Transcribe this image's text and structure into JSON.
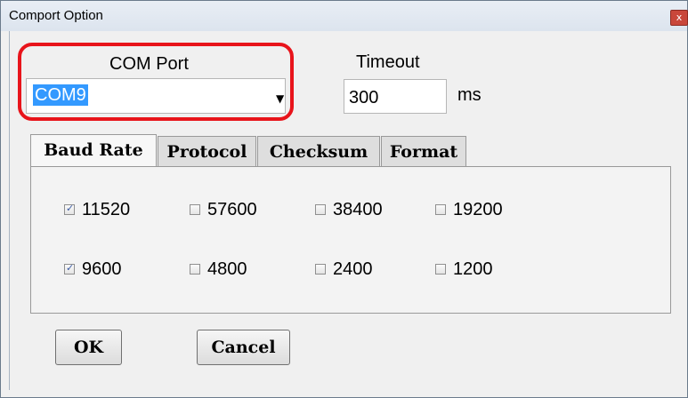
{
  "window": {
    "title": "Comport Option",
    "close_glyph": "x"
  },
  "com_port": {
    "label": "COM Port",
    "value": "COM9",
    "arrow": "▼"
  },
  "timeout": {
    "label": "Timeout",
    "value": "300",
    "unit": "ms"
  },
  "tabs": [
    "Baud Rate",
    "Protocol",
    "Checksum",
    "Format"
  ],
  "active_tab": "Baud Rate",
  "baud_rates": [
    {
      "label": "11520",
      "checked": true
    },
    {
      "label": "57600",
      "checked": false
    },
    {
      "label": "38400",
      "checked": false
    },
    {
      "label": "19200",
      "checked": false
    },
    {
      "label": "9600",
      "checked": true
    },
    {
      "label": "4800",
      "checked": false
    },
    {
      "label": "2400",
      "checked": false
    },
    {
      "label": "1200",
      "checked": false
    }
  ],
  "check_glyph": "✓",
  "buttons": {
    "ok": "OK",
    "cancel": "Cancel"
  },
  "colors": {
    "highlight": "#e8141b",
    "selection": "#3399ff"
  }
}
